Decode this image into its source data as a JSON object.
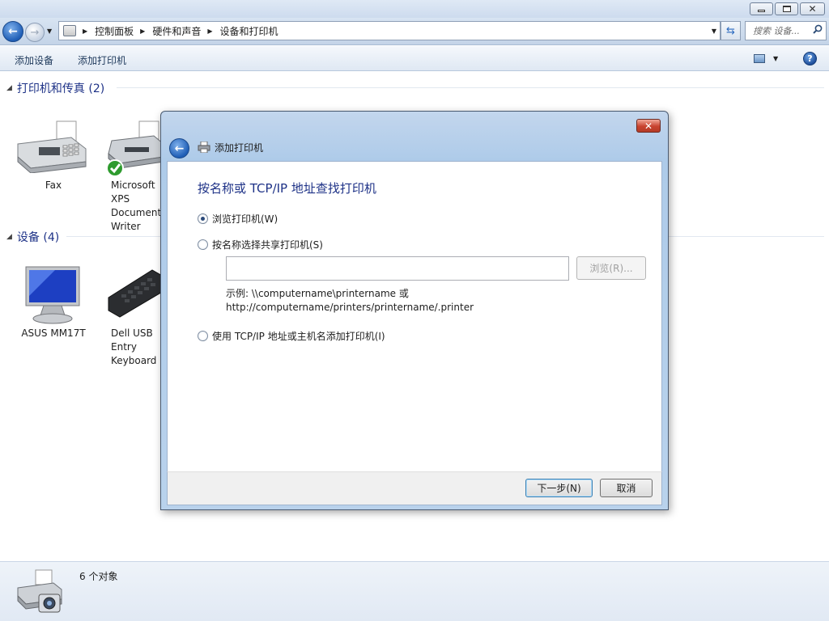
{
  "window": {
    "min_label": "—",
    "max_label": "❐",
    "close_label": "✕"
  },
  "nav": {
    "breadcrumbs": [
      "控制面板",
      "硬件和声音",
      "设备和打印机"
    ],
    "search_placeholder": "搜索 设备...",
    "back_icon": "back-arrow-icon",
    "forward_icon": "forward-arrow-icon"
  },
  "toolbar": {
    "add_device": "添加设备",
    "add_printer": "添加打印机"
  },
  "groups": {
    "printers": {
      "header": "打印机和传真 (2)",
      "items": [
        {
          "label": "Fax"
        },
        {
          "label": "Microsoft XPS Document Writer"
        }
      ]
    },
    "devices": {
      "header": "设备 (4)",
      "items": [
        {
          "label": "ASUS MM17T"
        },
        {
          "label": "Dell USB Entry Keyboard"
        }
      ]
    }
  },
  "dialog": {
    "title": "添加打印机",
    "heading": "按名称或 TCP/IP 地址查找打印机",
    "options": [
      {
        "label": "浏览打印机(W)",
        "checked": true
      },
      {
        "label": "按名称选择共享打印机(S)",
        "checked": false
      },
      {
        "label": "使用 TCP/IP 地址或主机名添加打印机(I)",
        "checked": false
      }
    ],
    "name_input_value": "",
    "browse_label": "浏览(R)...",
    "example_line1": "示例: \\\\computername\\printername 或",
    "example_line2": "http://computername/printers/printername/.printer",
    "next_label": "下一步(N)",
    "cancel_label": "取消"
  },
  "status": {
    "count_text": "6 个对象"
  }
}
